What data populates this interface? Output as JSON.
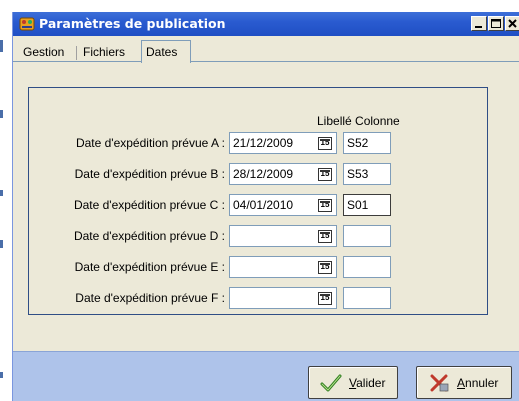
{
  "window": {
    "title": "Paramètres de publication"
  },
  "tabs": [
    {
      "label": "Gestion",
      "active": false
    },
    {
      "label": "Fichiers",
      "active": false
    },
    {
      "label": "Dates",
      "active": true
    }
  ],
  "dates": {
    "column_header": "Libellé Colonne",
    "calendar_glyph": "15",
    "rows": [
      {
        "label": "Date d'expédition prévue A :",
        "date": "21/12/2009",
        "column": "S52"
      },
      {
        "label": "Date d'expédition prévue B :",
        "date": "28/12/2009",
        "column": "S53"
      },
      {
        "label": "Date d'expédition prévue C :",
        "date": "04/01/2010",
        "column": "S01"
      },
      {
        "label": "Date d'expédition prévue D :",
        "date": "",
        "column": ""
      },
      {
        "label": "Date d'expédition prévue E :",
        "date": "",
        "column": ""
      },
      {
        "label": "Date d'expédition prévue F :",
        "date": "",
        "column": ""
      }
    ]
  },
  "buttons": {
    "validate": {
      "label_mnemonic": "V",
      "label_rest": "alider",
      "icon": "checkmark-icon"
    },
    "cancel": {
      "label_mnemonic": "A",
      "label_rest": "nnuler",
      "icon": "cancel-icon"
    }
  },
  "colors": {
    "titlebar": "#2a5bd0",
    "footer": "#aec3ea",
    "dialog": "#ece9d8",
    "group_border": "#2f4e85"
  }
}
